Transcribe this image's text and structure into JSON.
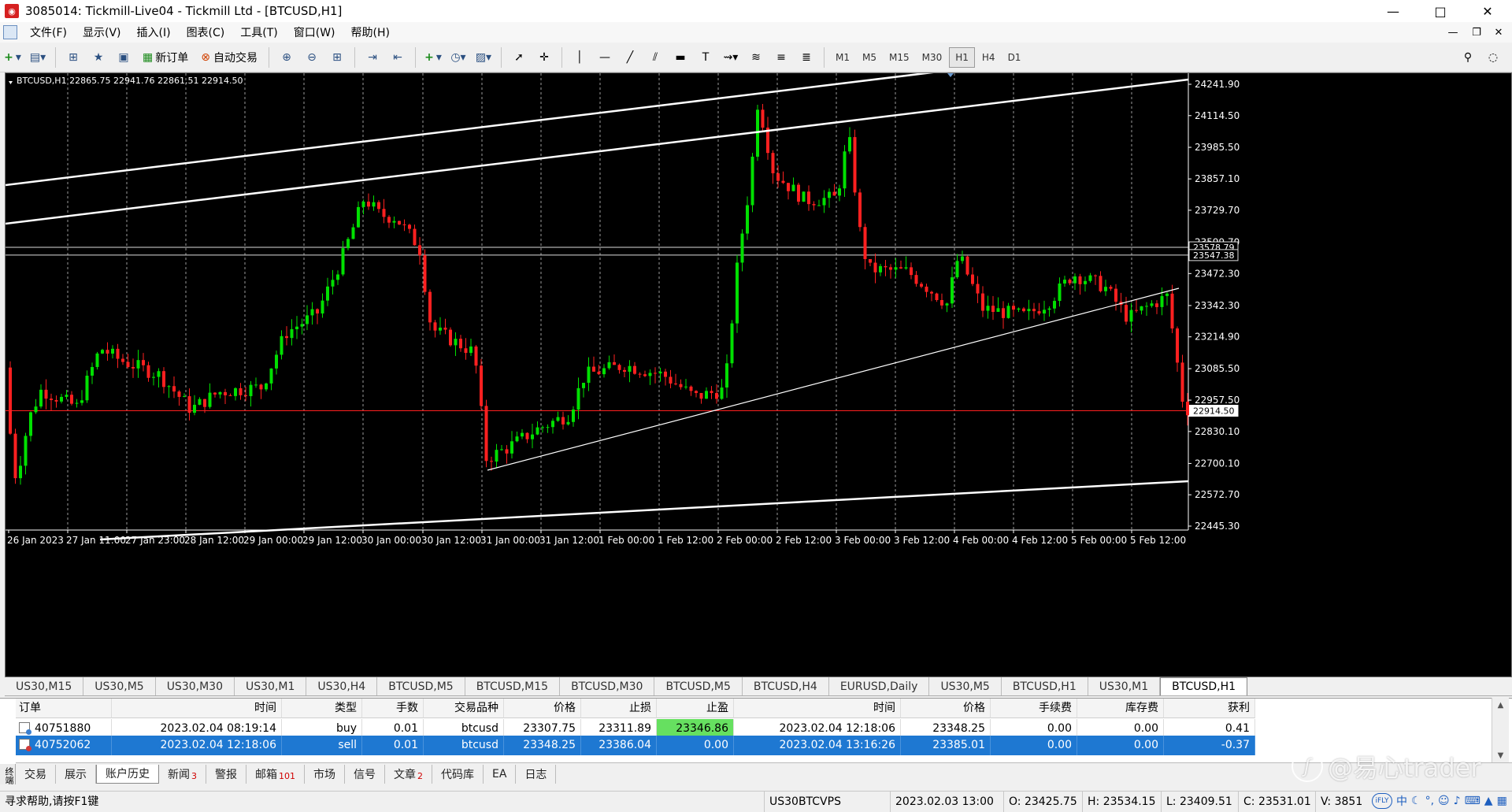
{
  "window": {
    "title": "3085014: Tickmill-Live04 - Tickmill Ltd - [BTCUSD,H1]",
    "app_icon": "mt4-app-icon",
    "controls": [
      "minimize-icon",
      "maximize-icon",
      "close-icon"
    ]
  },
  "menu": [
    "文件(F)",
    "显示(V)",
    "插入(I)",
    "图表(C)",
    "工具(T)",
    "窗口(W)",
    "帮助(H)"
  ],
  "toolbar": {
    "new_order_label": "新订单",
    "auto_trade_label": "自动交易",
    "timeframes": [
      "M1",
      "M5",
      "M15",
      "M30",
      "H1",
      "H4",
      "D1"
    ],
    "active_timeframe": "H1"
  },
  "chart": {
    "header": "BTCUSD,H1  22865.75 22941.76 22861.51 22914.50",
    "background": "#000000",
    "bull_color": "#00e000",
    "bear_color": "#ff2020",
    "price_ticks": [
      "24241.90",
      "24114.50",
      "23985.50",
      "23857.10",
      "23729.70",
      "23599.70",
      "23472.30",
      "23342.30",
      "23214.90",
      "23085.50",
      "22957.50",
      "22830.10",
      "22700.10",
      "22572.70",
      "22445.30"
    ],
    "level_labels": [
      "23578.79",
      "23547.38",
      "22914.50"
    ],
    "time_ticks": [
      "26 Jan 2023",
      "27 Jan 11:00",
      "27 Jan 23:00",
      "28 Jan 12:00",
      "29 Jan 00:00",
      "29 Jan 12:00",
      "30 Jan 00:00",
      "30 Jan 12:00",
      "31 Jan 00:00",
      "31 Jan 12:00",
      "1 Feb 00:00",
      "1 Feb 12:00",
      "2 Feb 00:00",
      "2 Feb 12:00",
      "3 Feb 00:00",
      "3 Feb 12:00",
      "4 Feb 00:00",
      "4 Feb 12:00",
      "5 Feb 00:00",
      "5 Feb 12:00"
    ]
  },
  "chart_tabs": [
    "US30,M15",
    "US30,M5",
    "US30,M30",
    "US30,M1",
    "US30,H4",
    "BTCUSD,M5",
    "BTCUSD,M15",
    "BTCUSD,M30",
    "BTCUSD,M5",
    "BTCUSD,H4",
    "EURUSD,Daily",
    "US30,M5",
    "BTCUSD,H1",
    "US30,M1",
    "BTCUSD,H1"
  ],
  "active_chart_tab": 14,
  "terminal": {
    "side_label": "终端",
    "columns": [
      "订单",
      "时间",
      "类型",
      "手数",
      "交易品种",
      "价格",
      "止损",
      "止盈",
      "时间",
      "价格",
      "手续费",
      "库存费",
      "获利"
    ],
    "rows": [
      [
        "40751880",
        "2023.02.04 08:19:14",
        "buy",
        "0.01",
        "btcusd",
        "23307.75",
        "23311.89",
        "23346.86",
        "2023.02.04 12:18:06",
        "23348.25",
        "0.00",
        "0.00",
        "0.41"
      ],
      [
        "40752062",
        "2023.02.04 12:18:06",
        "sell",
        "0.01",
        "btcusd",
        "23348.25",
        "23386.04",
        "0.00",
        "2023.02.04 13:16:26",
        "23385.01",
        "0.00",
        "0.00",
        "-0.37"
      ]
    ],
    "tp_hit_color": "#66e060",
    "tabs": [
      {
        "label": "交易",
        "badge": ""
      },
      {
        "label": "展示",
        "badge": ""
      },
      {
        "label": "账户历史",
        "badge": ""
      },
      {
        "label": "新闻",
        "badge": "3"
      },
      {
        "label": "警报",
        "badge": ""
      },
      {
        "label": "邮箱",
        "badge": "101"
      },
      {
        "label": "市场",
        "badge": ""
      },
      {
        "label": "信号",
        "badge": ""
      },
      {
        "label": "文章",
        "badge": "2"
      },
      {
        "label": "代码库",
        "badge": ""
      },
      {
        "label": "EA",
        "badge": ""
      },
      {
        "label": "日志",
        "badge": ""
      }
    ],
    "active_tab": 2
  },
  "watermark": "@易心trader",
  "status": {
    "help": "寻求帮助,请按F1键",
    "profile": "US30BTCVPS",
    "datetime": "2023.02.03 13:00",
    "open": "O: 23425.75",
    "high": "H: 23534.15",
    "low": "L: 23409.51",
    "close": "C: 23531.01",
    "volume": "V: 3851",
    "tray": [
      "iFLY",
      "中"
    ]
  }
}
